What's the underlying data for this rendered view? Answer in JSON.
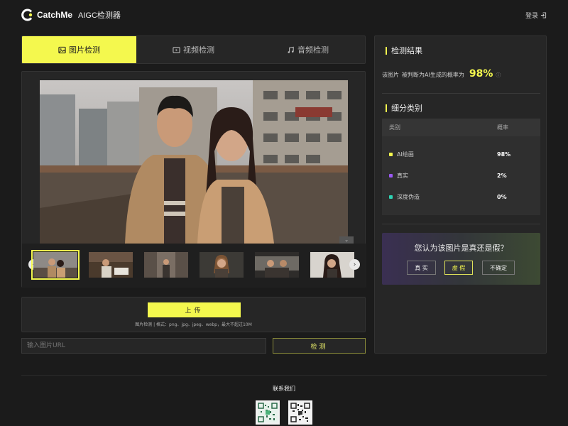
{
  "header": {
    "brand": "CatchMe",
    "brand_sub": "AIGC检测器",
    "login": "登录"
  },
  "tabs": [
    {
      "label": "图片检测",
      "icon": "image-icon",
      "active": true
    },
    {
      "label": "视频检测",
      "icon": "video-icon",
      "active": false
    },
    {
      "label": "音频检测",
      "icon": "music-icon",
      "active": false
    }
  ],
  "upload": {
    "button": "上传",
    "hint": "图片检测 | 格式：png、jpg、jpeg、webp，最大不超过10M"
  },
  "url": {
    "placeholder": "输入图片URL",
    "button": "检测"
  },
  "results": {
    "title": "检测结果",
    "subject": "该图片",
    "verdict_prefix": "被判断为AI生成的概率为",
    "probability": "98%",
    "breakdown_title": "细分类别",
    "col_category": "类别",
    "col_probability": "概率",
    "rows": [
      {
        "name": "AI绘画",
        "value": "98%",
        "color": "#f4f84e"
      },
      {
        "name": "真实",
        "value": "2%",
        "color": "#9b59f5"
      },
      {
        "name": "深度伪造",
        "value": "0%",
        "color": "#2ed3b3"
      }
    ]
  },
  "question": {
    "text": "您认为该图片是真还是假？",
    "options": [
      "真 实",
      "虚 假",
      "不确定"
    ]
  },
  "footer": {
    "contact": "联系我们"
  },
  "colors": {
    "accent": "#f4f84e",
    "background": "#1b1b1b",
    "panel": "#262626"
  }
}
